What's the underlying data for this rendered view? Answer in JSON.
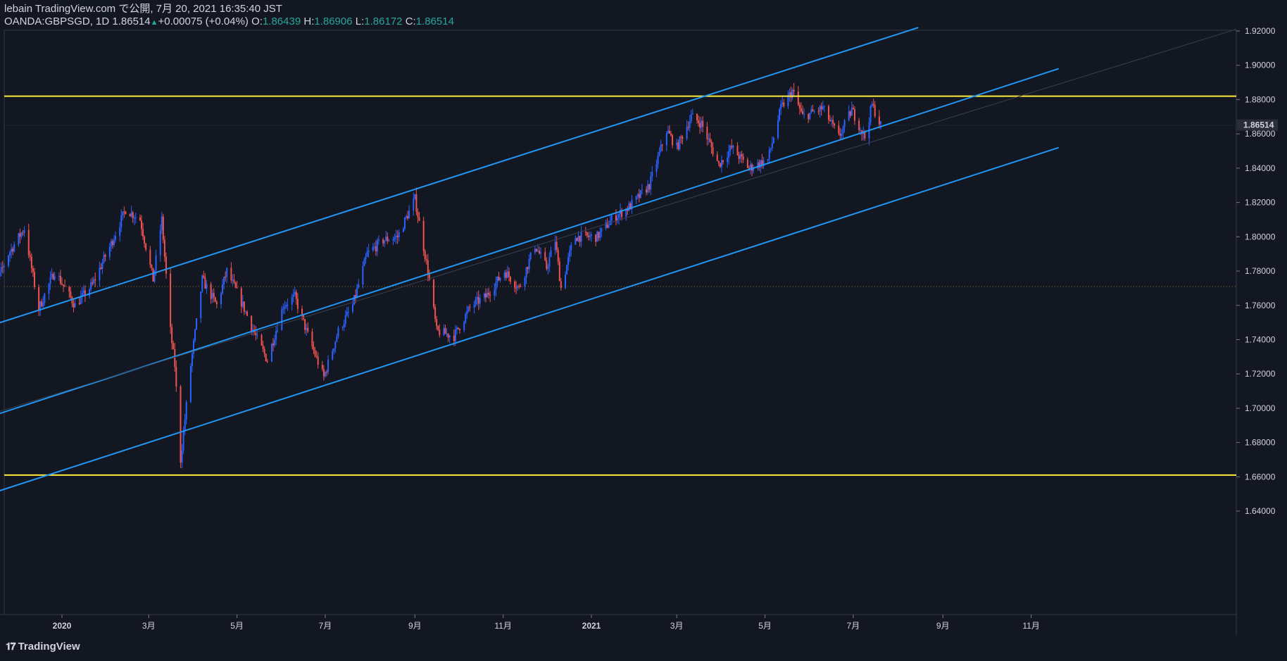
{
  "header": {
    "publish_line": "lebain TradingView.com で公開, 7月 20, 2021 16:35:40 JST",
    "symbol": "OANDA:GBPSGD, 1D",
    "last": "1.86514",
    "change": "+0.00075 (+0.04%)",
    "o_label": "O:",
    "o_value": "1.86439",
    "h_label": "H:",
    "h_value": "1.86906",
    "l_label": "L:",
    "l_value": "1.86172",
    "c_label": "C:",
    "c_value": "1.86514"
  },
  "footer": {
    "brand": "TradingView"
  },
  "colors": {
    "background": "#131722",
    "up": "#2962ff",
    "down": "#ef5350",
    "channel": "#2196f3",
    "horizontal": "#ffeb3b",
    "text": "#d1d4dc"
  },
  "chart_data": {
    "type": "candlestick",
    "y_axis": {
      "range": [
        1.63,
        1.922
      ],
      "ticks": [
        "1.64000",
        "1.66000",
        "1.68000",
        "1.70000",
        "1.72000",
        "1.74000",
        "1.76000",
        "1.78000",
        "1.80000",
        "1.82000",
        "1.84000",
        "1.86000",
        "1.88000",
        "1.90000",
        "1.92000"
      ],
      "current_price_label": "1.86514"
    },
    "x_axis": {
      "ticks": [
        {
          "label": "2020",
          "date": "2020-01-01",
          "bold": true
        },
        {
          "label": "3月",
          "date": "2020-03-01"
        },
        {
          "label": "5月",
          "date": "2020-05-01"
        },
        {
          "label": "7月",
          "date": "2020-07-01"
        },
        {
          "label": "9月",
          "date": "2020-09-01"
        },
        {
          "label": "11月",
          "date": "2020-11-01"
        },
        {
          "label": "2021",
          "date": "2021-01-01",
          "bold": true
        },
        {
          "label": "3月",
          "date": "2021-03-01"
        },
        {
          "label": "5月",
          "date": "2021-05-01"
        },
        {
          "label": "7月",
          "date": "2021-07-01"
        },
        {
          "label": "9月",
          "date": "2021-09-01"
        },
        {
          "label": "11月",
          "date": "2021-11-01"
        }
      ]
    },
    "price_path": [
      [
        "2019-11-08",
        1.755
      ],
      [
        "2019-11-25",
        1.79
      ],
      [
        "2019-12-06",
        1.805
      ],
      [
        "2019-12-16",
        1.758
      ],
      [
        "2019-12-27",
        1.78
      ],
      [
        "2020-01-10",
        1.76
      ],
      [
        "2020-01-22",
        1.772
      ],
      [
        "2020-02-04",
        1.796
      ],
      [
        "2020-02-14",
        1.816
      ],
      [
        "2020-02-24",
        1.81
      ],
      [
        "2020-03-04",
        1.775
      ],
      [
        "2020-03-10",
        1.81
      ],
      [
        "2020-03-16",
        1.745
      ],
      [
        "2020-03-19",
        1.725
      ],
      [
        "2020-03-23",
        1.67
      ],
      [
        "2020-03-30",
        1.725
      ],
      [
        "2020-04-07",
        1.775
      ],
      [
        "2020-04-17",
        1.76
      ],
      [
        "2020-04-24",
        1.78
      ],
      [
        "2020-05-05",
        1.76
      ],
      [
        "2020-05-15",
        1.74
      ],
      [
        "2020-05-22",
        1.728
      ],
      [
        "2020-06-02",
        1.76
      ],
      [
        "2020-06-10",
        1.765
      ],
      [
        "2020-06-20",
        1.74
      ],
      [
        "2020-06-30",
        1.718
      ],
      [
        "2020-07-10",
        1.745
      ],
      [
        "2020-07-20",
        1.76
      ],
      [
        "2020-07-30",
        1.79
      ],
      [
        "2020-08-10",
        1.798
      ],
      [
        "2020-08-20",
        1.8
      ],
      [
        "2020-09-01",
        1.822
      ],
      [
        "2020-09-10",
        1.78
      ],
      [
        "2020-09-16",
        1.745
      ],
      [
        "2020-09-28",
        1.742
      ],
      [
        "2020-10-10",
        1.76
      ],
      [
        "2020-10-20",
        1.765
      ],
      [
        "2020-11-02",
        1.78
      ],
      [
        "2020-11-12",
        1.77
      ],
      [
        "2020-11-23",
        1.795
      ],
      [
        "2020-12-01",
        1.782
      ],
      [
        "2020-12-07",
        1.798
      ],
      [
        "2020-12-11",
        1.77
      ],
      [
        "2020-12-20",
        1.8
      ],
      [
        "2021-01-05",
        1.8
      ],
      [
        "2021-01-15",
        1.81
      ],
      [
        "2021-01-28",
        1.818
      ],
      [
        "2021-02-10",
        1.83
      ],
      [
        "2021-02-22",
        1.862
      ],
      [
        "2021-03-01",
        1.852
      ],
      [
        "2021-03-11",
        1.87
      ],
      [
        "2021-03-18",
        1.866
      ],
      [
        "2021-03-30",
        1.842
      ],
      [
        "2021-04-08",
        1.852
      ],
      [
        "2021-04-20",
        1.84
      ],
      [
        "2021-05-03",
        1.845
      ],
      [
        "2021-05-12",
        1.875
      ],
      [
        "2021-05-20",
        1.885
      ],
      [
        "2021-05-27",
        1.87
      ],
      [
        "2021-06-10",
        1.875
      ],
      [
        "2021-06-21",
        1.858
      ],
      [
        "2021-06-30",
        1.874
      ],
      [
        "2021-07-09",
        1.858
      ],
      [
        "2021-07-14",
        1.877
      ],
      [
        "2021-07-20",
        1.865
      ]
    ],
    "horizontal_levels": [
      1.882,
      1.661
    ],
    "channel_lines": [
      {
        "role": "upper",
        "p1": [
          "2019-11-01",
          1.745
        ],
        "p2": [
          "2021-08-15",
          1.922
        ]
      },
      {
        "role": "middle",
        "p1": [
          "2019-11-01",
          1.692
        ],
        "p2": [
          "2021-11-20",
          1.898
        ]
      },
      {
        "role": "lower",
        "p1": [
          "2019-11-01",
          1.647
        ],
        "p2": [
          "2021-11-20",
          1.852
        ]
      }
    ],
    "dotted_level": 1.771
  }
}
